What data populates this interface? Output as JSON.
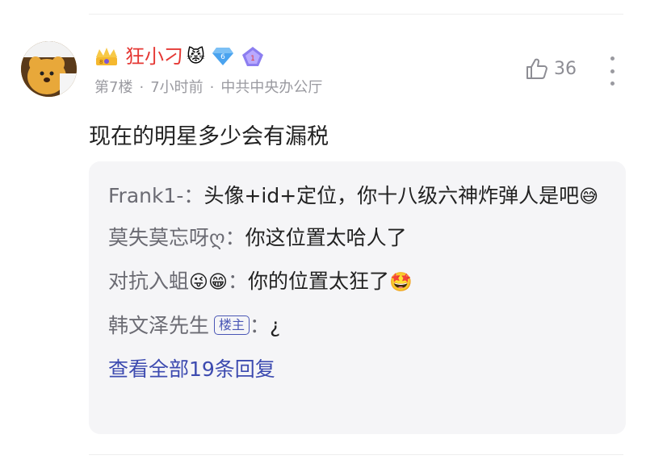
{
  "comment": {
    "user": {
      "name": "狂小刁",
      "name_emoji": "😾",
      "level": "6",
      "rank": "1"
    },
    "floor": "第7楼",
    "time": "7小时前",
    "location": "中共中央办公厅",
    "likes": "36",
    "text": "现在的明星多少会有漏税"
  },
  "replies": [
    {
      "author": "Frank1-",
      "separator": "：",
      "text": "头像+id+定位，你十八级六神炸弹人是吧",
      "emoji": "😅"
    },
    {
      "author": "莫失莫忘呀ღ",
      "separator": "：",
      "text": "你这位置太哈人了",
      "emoji": ""
    },
    {
      "author": "对抗入蛆",
      "author_emojis": "😜😁",
      "separator": "：",
      "text": "你的位置太狂了",
      "emoji": "🤩"
    },
    {
      "author": "韩文泽先生",
      "badge": "楼主",
      "separator": "：",
      "text": "¿",
      "emoji": ""
    }
  ],
  "view_all": "查看全部19条回复",
  "colors": {
    "username": "#e53935",
    "link": "#3d4bb0",
    "meta": "#9a9aa0",
    "reply_bg": "#f5f5f7"
  }
}
